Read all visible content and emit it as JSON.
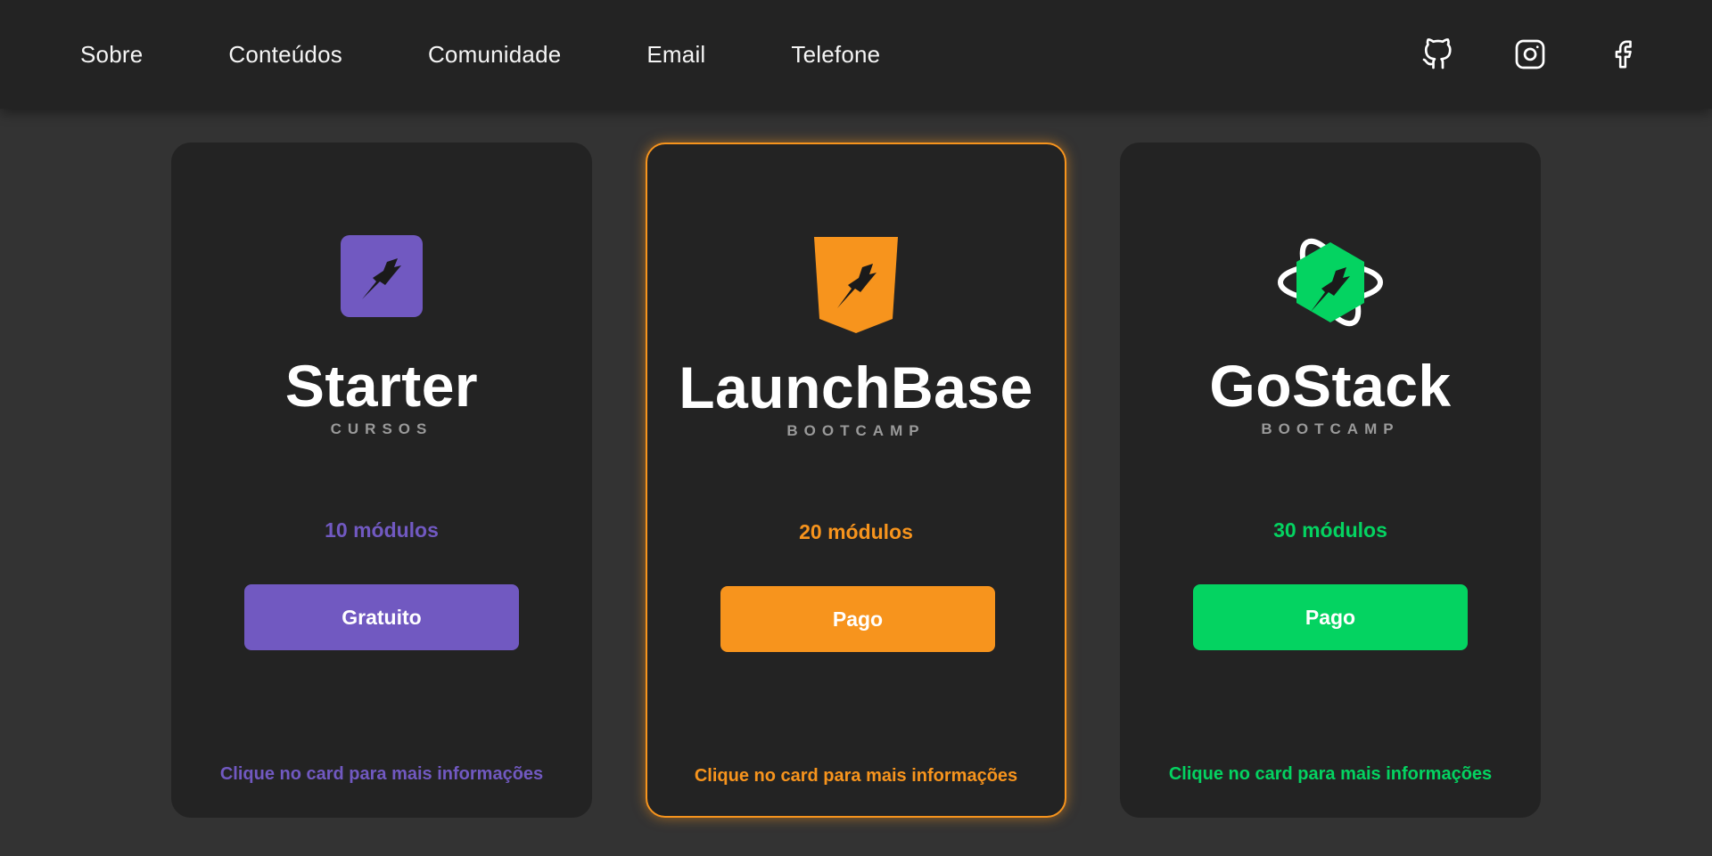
{
  "nav": {
    "items": [
      "Sobre",
      "Conteúdos",
      "Comunidade",
      "Email",
      "Telefone"
    ],
    "social_icons": [
      "github-icon",
      "instagram-icon",
      "facebook-icon"
    ]
  },
  "cards": [
    {
      "title": "Starter",
      "subtitle": "CURSOS",
      "modules": "10 módulos",
      "button": "Gratuito",
      "hint": "Clique no card para mais informações",
      "color": "#7159c1",
      "icon": "rocket-square-icon"
    },
    {
      "title": "LaunchBase",
      "subtitle": "BOOTCAMP",
      "modules": "20 módulos",
      "button": "Pago",
      "hint": "Clique no card para mais informações",
      "color": "#f7941d",
      "icon": "rocket-shield-icon"
    },
    {
      "title": "GoStack",
      "subtitle": "BOOTCAMP",
      "modules": "30 módulos",
      "button": "Pago",
      "hint": "Clique no card para mais informações",
      "color": "#04d361",
      "icon": "rocket-atom-icon"
    }
  ]
}
